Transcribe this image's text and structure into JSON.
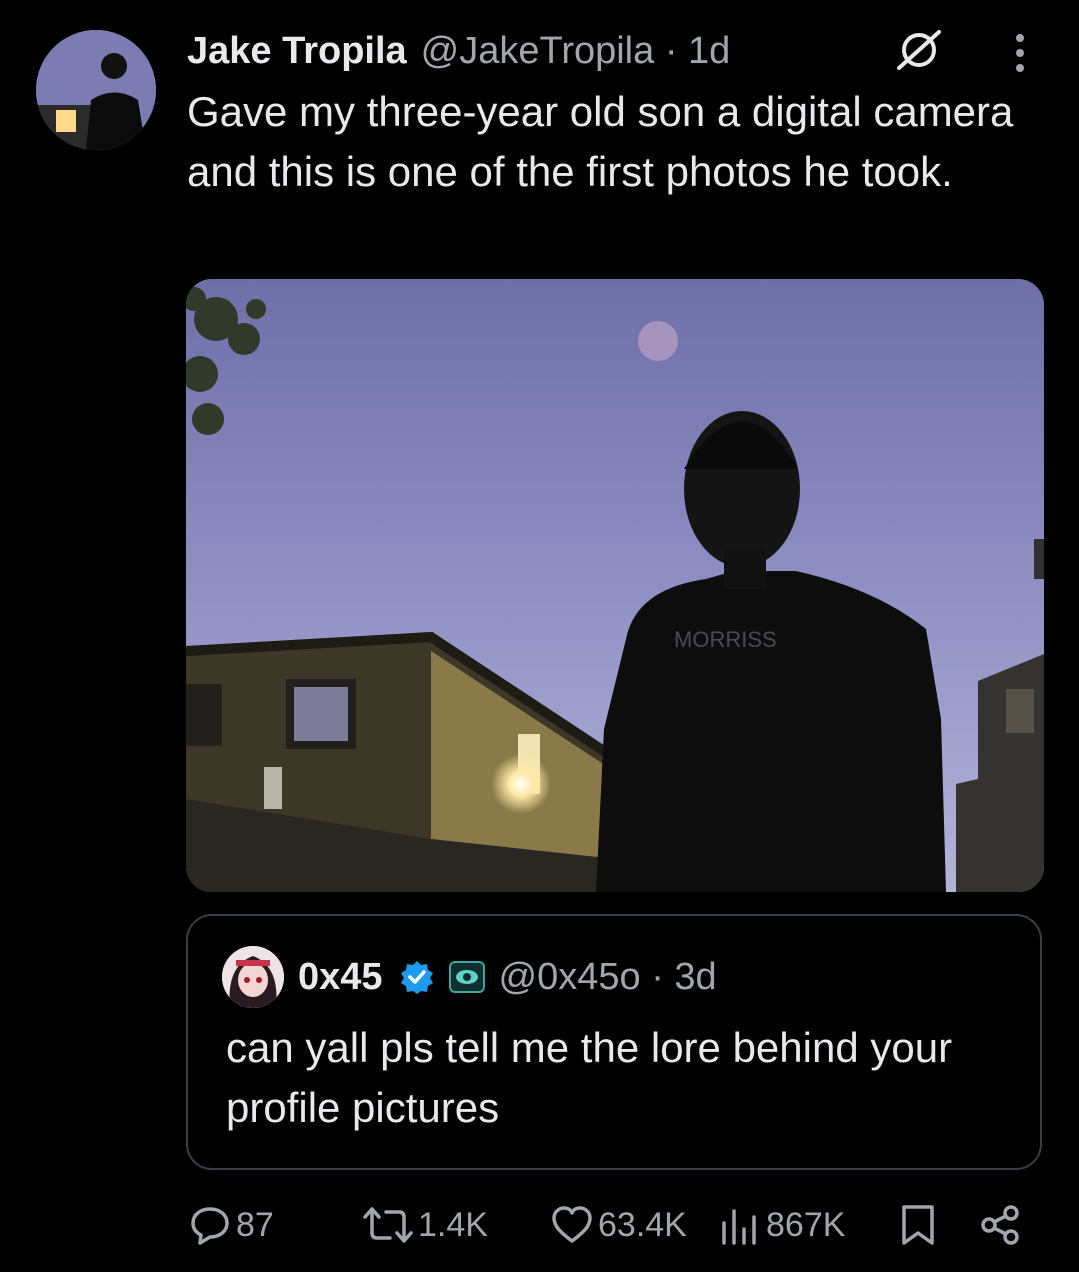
{
  "tweet": {
    "author_name": "Jake Tropila",
    "handle_time": "@JakeTropila · 1d",
    "text": "Gave my three-year old son a digital camera and this is one of the first photos he took.",
    "media": {
      "description_icon": "photo",
      "shirt_text": "MORRISS"
    }
  },
  "quoted_tweet": {
    "author_name": "0x45",
    "handle_time": "@0x45o · 3d",
    "text": "can yall pls tell me the lore behind your profile pictures"
  },
  "actions": {
    "replies": "87",
    "reposts": "1.4K",
    "likes": "63.4K",
    "views": "867K"
  },
  "colors": {
    "background": "#000000",
    "text": "#e7e9ea",
    "muted": "#a1a6ab",
    "border": "#3a3f44",
    "verified": "#1d9bf0"
  }
}
